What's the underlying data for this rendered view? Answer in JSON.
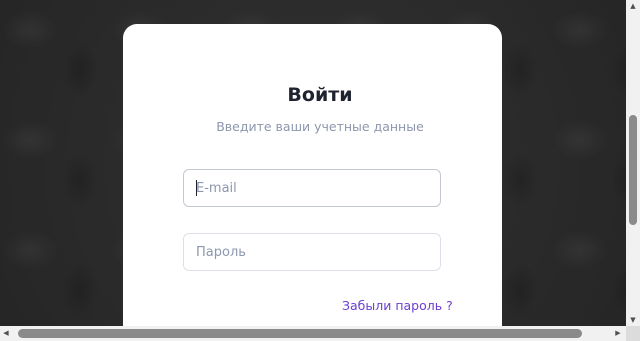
{
  "login": {
    "title": "Войти",
    "subtitle": "Введите ваши учетные данные",
    "email": {
      "value": "",
      "placeholder": "E-mail"
    },
    "password": {
      "value": "",
      "placeholder": "Пароль"
    },
    "forgot_password": "Забыли пароль ?"
  },
  "scrollbars": {
    "up": "▲",
    "down": "▼",
    "left": "◀",
    "right": "▶"
  },
  "colors": {
    "background": "#2b2b2b",
    "card": "#ffffff",
    "title": "#1f2330",
    "muted": "#8d97ad",
    "link": "#6d3fd1",
    "border": "#cfd4dc"
  }
}
